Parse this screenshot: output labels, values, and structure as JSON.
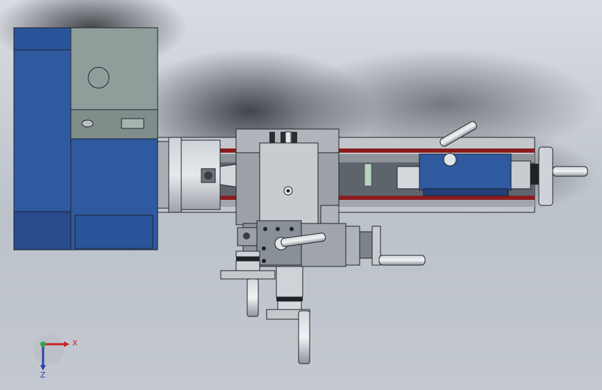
{
  "viewport": {
    "background_top": "#d9dde3",
    "background_bottom": "#c4c9d0"
  },
  "colors": {
    "headstock_blue": "#2f5aa0",
    "headstock_dark": "#223f77",
    "panel_gray": "#8f9e9b",
    "steel_light": "#c8ccd1",
    "steel_mid": "#a9aeb5",
    "steel_dark": "#6d737b",
    "rail_red": "#8b1b1f",
    "tailstock_blue": "#2f5aa0",
    "outline": "#1e2227"
  },
  "axis_triad": {
    "x_label": "X",
    "z_label": "Z",
    "x_color": "#c8222a",
    "y_color": "#2fa84a",
    "z_color": "#2a3fb0"
  }
}
